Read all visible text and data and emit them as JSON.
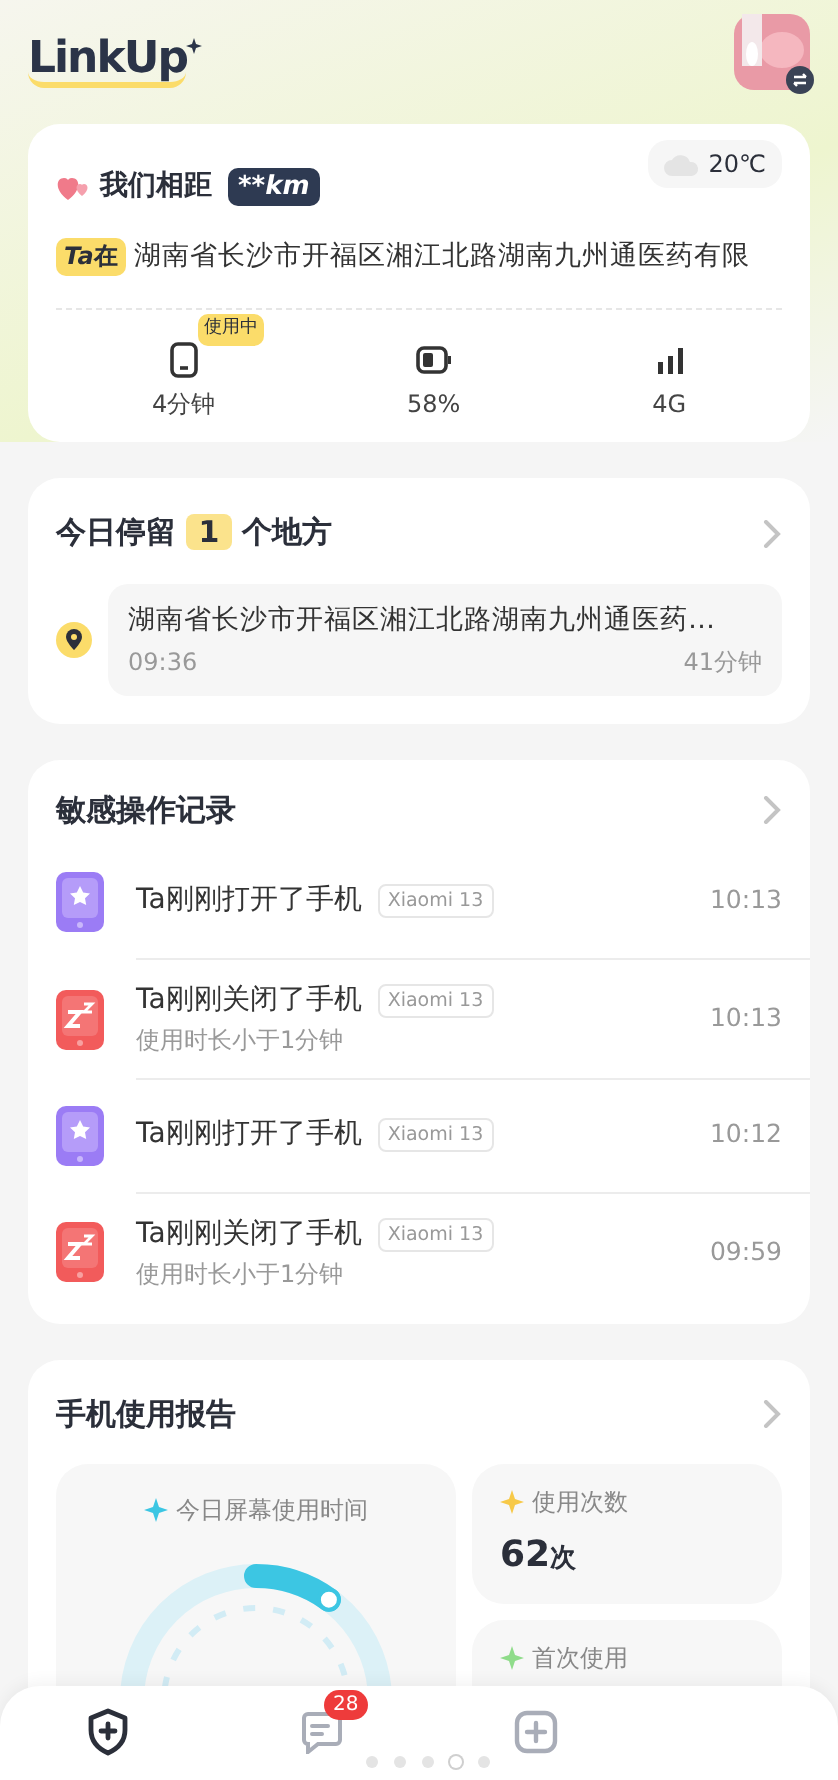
{
  "header": {
    "logo": "LinkUp"
  },
  "status_card": {
    "title": "我们相距",
    "distance": "**km",
    "weather": "20℃",
    "location_tag": "Ta在",
    "address": "湖南省长沙市开福区湘江北路湖南九州通医药有限",
    "stats": [
      {
        "kind": "screen",
        "value": "4分钟",
        "badge": "使用中"
      },
      {
        "kind": "battery",
        "value": "58%"
      },
      {
        "kind": "signal",
        "value": "4G"
      }
    ]
  },
  "stays": {
    "title_before": "今日停留",
    "count": "1",
    "title_after": "个地方",
    "places": [
      {
        "address": "湖南省长沙市开福区湘江北路湖南九州通医药…",
        "time": "09:36",
        "duration": "41分钟"
      }
    ]
  },
  "records": {
    "title": "敏感操作记录",
    "items": [
      {
        "kind": "open",
        "text": "Ta刚刚打开了手机",
        "device": "Xiaomi 13",
        "time": "10:13"
      },
      {
        "kind": "close",
        "text": "Ta刚刚关闭了手机",
        "device": "Xiaomi 13",
        "note": "使用时长小于1分钟",
        "time": "10:13"
      },
      {
        "kind": "open",
        "text": "Ta刚刚打开了手机",
        "device": "Xiaomi 13",
        "time": "10:12"
      },
      {
        "kind": "close",
        "text": "Ta刚刚关闭了手机",
        "device": "Xiaomi 13",
        "note": "使用时长小于1分钟",
        "time": "09:59"
      }
    ]
  },
  "report": {
    "title": "手机使用报告",
    "screen_time": {
      "label": "今日屏幕使用时间",
      "level": 0.1
    },
    "count": {
      "label": "使用次数",
      "value": "62",
      "unit": "次"
    },
    "first_use": {
      "label": "首次使用"
    }
  },
  "nav": [
    {
      "kind": "shield",
      "selected": true
    },
    {
      "kind": "message",
      "selected": false,
      "badge": "28"
    },
    {
      "kind": "add",
      "selected": false
    }
  ],
  "page_dots": [
    {
      "selected": false
    },
    {
      "selected": false
    },
    {
      "selected": false
    },
    {
      "selected": true
    },
    {
      "selected": false
    }
  ]
}
